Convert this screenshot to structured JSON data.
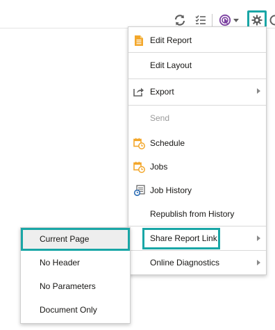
{
  "toolbar": {
    "icons": [
      "refresh-icon",
      "checklist-icon",
      "bi-catalog-icon",
      "gear-icon",
      "help-icon"
    ],
    "accent_color": "#19a6a6",
    "bi_icon_color": "#7a3fa0"
  },
  "menu": {
    "items": [
      {
        "label": "Edit Report",
        "icon": "document-edit-icon"
      },
      {
        "label": "Edit Layout"
      },
      {
        "label": "Export",
        "icon": "export-icon",
        "has_submenu": true
      },
      {
        "label": "Send",
        "disabled": true
      },
      {
        "label": "Schedule",
        "icon": "calendar-clock-icon"
      },
      {
        "label": "Jobs",
        "icon": "calendar-clock-icon"
      },
      {
        "label": "Job History",
        "icon": "job-history-icon"
      },
      {
        "label": "Republish from History"
      },
      {
        "label": "Share Report Link",
        "has_submenu": true,
        "highlighted": true
      },
      {
        "label": "Online Diagnostics",
        "has_submenu": true
      }
    ]
  },
  "submenu": {
    "items": [
      {
        "label": "Current Page",
        "selected": true
      },
      {
        "label": "No Header"
      },
      {
        "label": "No Parameters"
      },
      {
        "label": "Document Only"
      }
    ]
  },
  "colors": {
    "icon_orange": "#f3a72b",
    "icon_gray": "#5f5f5f",
    "disabled_text": "#9a9a9a",
    "highlight_border": "#19a6a6"
  }
}
